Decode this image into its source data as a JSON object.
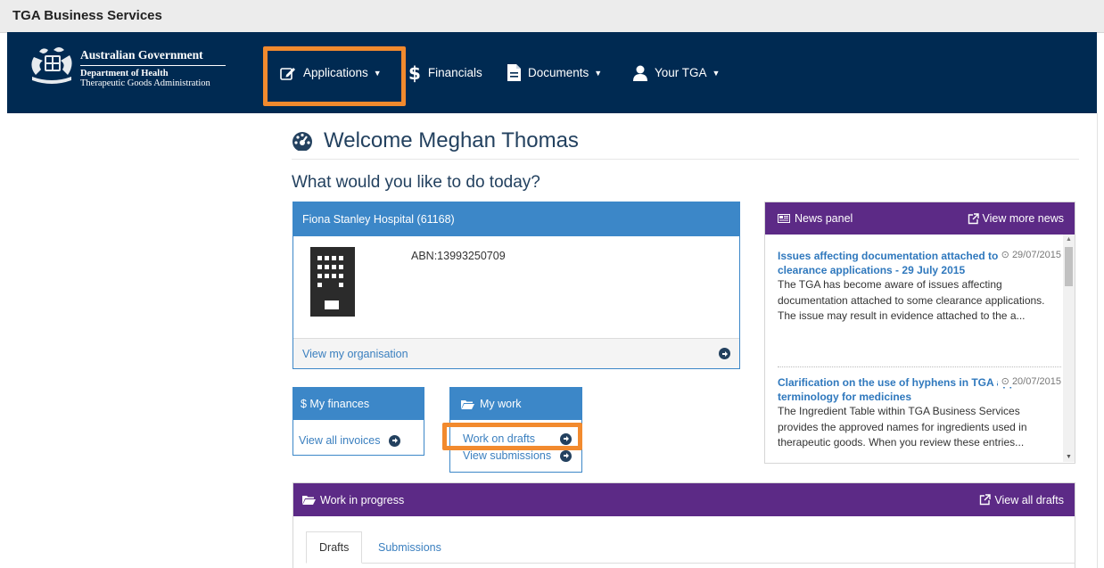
{
  "window": {
    "title": "TGA Business Services"
  },
  "logo": {
    "line1": "Australian Government",
    "line2": "Department of Health",
    "line3": "Therapeutic Goods Administration"
  },
  "nav": {
    "applications": "Applications",
    "financials": "Financials",
    "documents": "Documents",
    "your_tga": "Your TGA"
  },
  "welcome": {
    "title": "Welcome Meghan Thomas",
    "question": "What would you like to do today?"
  },
  "organisation": {
    "name": "Fiona Stanley Hospital (61168)",
    "abn": "ABN:13993250709",
    "view_link": "View my organisation"
  },
  "finances": {
    "title": "$ My finances",
    "link": "View all invoices"
  },
  "my_work": {
    "title": "My work",
    "link_drafts": "Work on drafts",
    "link_submissions": "View submissions"
  },
  "news": {
    "title": "News panel",
    "more_link": "View more news",
    "items": [
      {
        "title": "Issues affecting documentation attached to some GMP clearance applications - 29 July 2015",
        "date": "29/07/2015",
        "body": "The TGA has become aware of issues affecting documentation attached to some clearance applications. The issue may result in evidence attached to the a..."
      },
      {
        "title": "Clarification on the use of hyphens in TGA approved terminology for medicines",
        "date": "20/07/2015",
        "body": "The Ingredient Table within TGA Business Services provides the approved names for ingredients used in therapeutic goods. When you review these entries..."
      }
    ]
  },
  "work_in_progress": {
    "title": "Work in progress",
    "view_all": "View all drafts",
    "tabs": [
      "Drafts",
      "Submissions"
    ]
  },
  "colors": {
    "navbar": "#002a52",
    "highlight": "#f28a2e",
    "panel_blue": "#3c87c8",
    "panel_purple": "#5c2a86",
    "link": "#3a7fbf"
  },
  "icons": {
    "applications": "edit-icon",
    "financials": "dollar-icon",
    "documents": "file-icon",
    "your_tga": "user-icon",
    "welcome": "dashboard-icon",
    "organisation": "building-icon",
    "news": "newspaper-icon",
    "external": "external-link-icon",
    "folder": "folder-open-icon",
    "date": "clock-icon",
    "link_arrow": "circle-arrow-right-icon"
  }
}
